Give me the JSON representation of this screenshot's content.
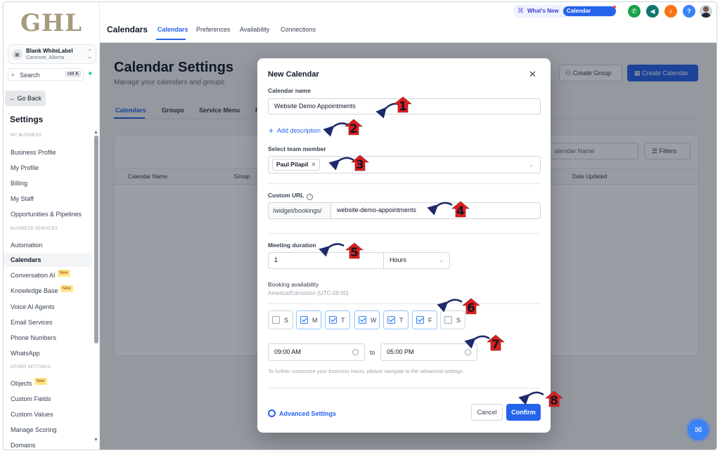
{
  "sidebar": {
    "logo": "GHL",
    "account": {
      "name": "Blank WhiteLabel",
      "location": "Canmore, Alberta"
    },
    "search": {
      "label": "Search",
      "shortcut": "ctrl K"
    },
    "go_back": "← Go Back",
    "settings_heading": "Settings",
    "sections": [
      "MY BUSINESS",
      "BUSINESS SERVICES",
      "OTHER SETTINGS"
    ],
    "items": [
      {
        "label": "Business Profile"
      },
      {
        "label": "My Profile"
      },
      {
        "label": "Billing"
      },
      {
        "label": "My Staff"
      },
      {
        "label": "Opportunities & Pipelines"
      },
      {
        "label": "Automation"
      },
      {
        "label": "Calendars"
      },
      {
        "label": "Conversation AI",
        "badge": "New"
      },
      {
        "label": "Knowledge Base",
        "badge": "New"
      },
      {
        "label": "Voice AI Agents"
      },
      {
        "label": "Email Services"
      },
      {
        "label": "Phone Numbers"
      },
      {
        "label": "WhatsApp"
      },
      {
        "label": "Objects",
        "badge": "New"
      },
      {
        "label": "Custom Fields"
      },
      {
        "label": "Custom Values"
      },
      {
        "label": "Manage Scoring"
      },
      {
        "label": "Domains"
      }
    ]
  },
  "topbar": {
    "title": "Calendars",
    "tabs": [
      "Calendars",
      "Preferences",
      "Availability",
      "Connections"
    ],
    "whats_new": "What's New",
    "calendar_updates": "Calendar Updates",
    "help": "?"
  },
  "page": {
    "title": "Calendar Settings",
    "subtitle": "Manage your calendars and groups",
    "create_group": "Create Group",
    "create_calendar": "Create Calendar",
    "tabs": [
      "Calendars",
      "Groups",
      "Service Menu",
      "Ro"
    ],
    "search_placeholder": "alendar Name",
    "filters": "Filters",
    "columns": [
      "Calendar Name",
      "Group",
      "Date Updated"
    ]
  },
  "modal": {
    "title": "New Calendar",
    "close": "✕",
    "calendar_name_label": "Calendar name",
    "calendar_name_value": "Website Demo Appointments",
    "add_description": "Add description",
    "team_member_label": "Select team member",
    "team_member_chip": "Paul Pilapil",
    "custom_url_label": "Custom URL",
    "url_prefix": "/widget/bookings/",
    "url_slug": "website-demo-appointments",
    "meeting_duration_label": "Meeting duration",
    "duration_value": "1",
    "duration_unit": "Hours",
    "booking_availability_label": "Booking availability",
    "timezone": "America/Edmonton (UTC-06:00)",
    "days": [
      {
        "label": "S",
        "checked": false
      },
      {
        "label": "M",
        "checked": true
      },
      {
        "label": "T",
        "checked": true
      },
      {
        "label": "W",
        "checked": true
      },
      {
        "label": "T",
        "checked": true
      },
      {
        "label": "F",
        "checked": true
      },
      {
        "label": "S",
        "checked": false
      }
    ],
    "start_time": "09:00 AM",
    "to": "to",
    "end_time": "05:00 PM",
    "hint": "To further customize your business hours, please navigate to the advanced settings.",
    "advanced_settings": "Advanced Settings",
    "cancel": "Cancel",
    "confirm": "Confirm"
  },
  "annotations": [
    "1",
    "2",
    "3",
    "4",
    "5",
    "6",
    "7",
    "8"
  ],
  "colors": {
    "accent": "#2563eb",
    "annotation_red": "#e11d1d",
    "arrow_navy": "#1e2a6b",
    "logo_gold": "#a79a7c"
  }
}
